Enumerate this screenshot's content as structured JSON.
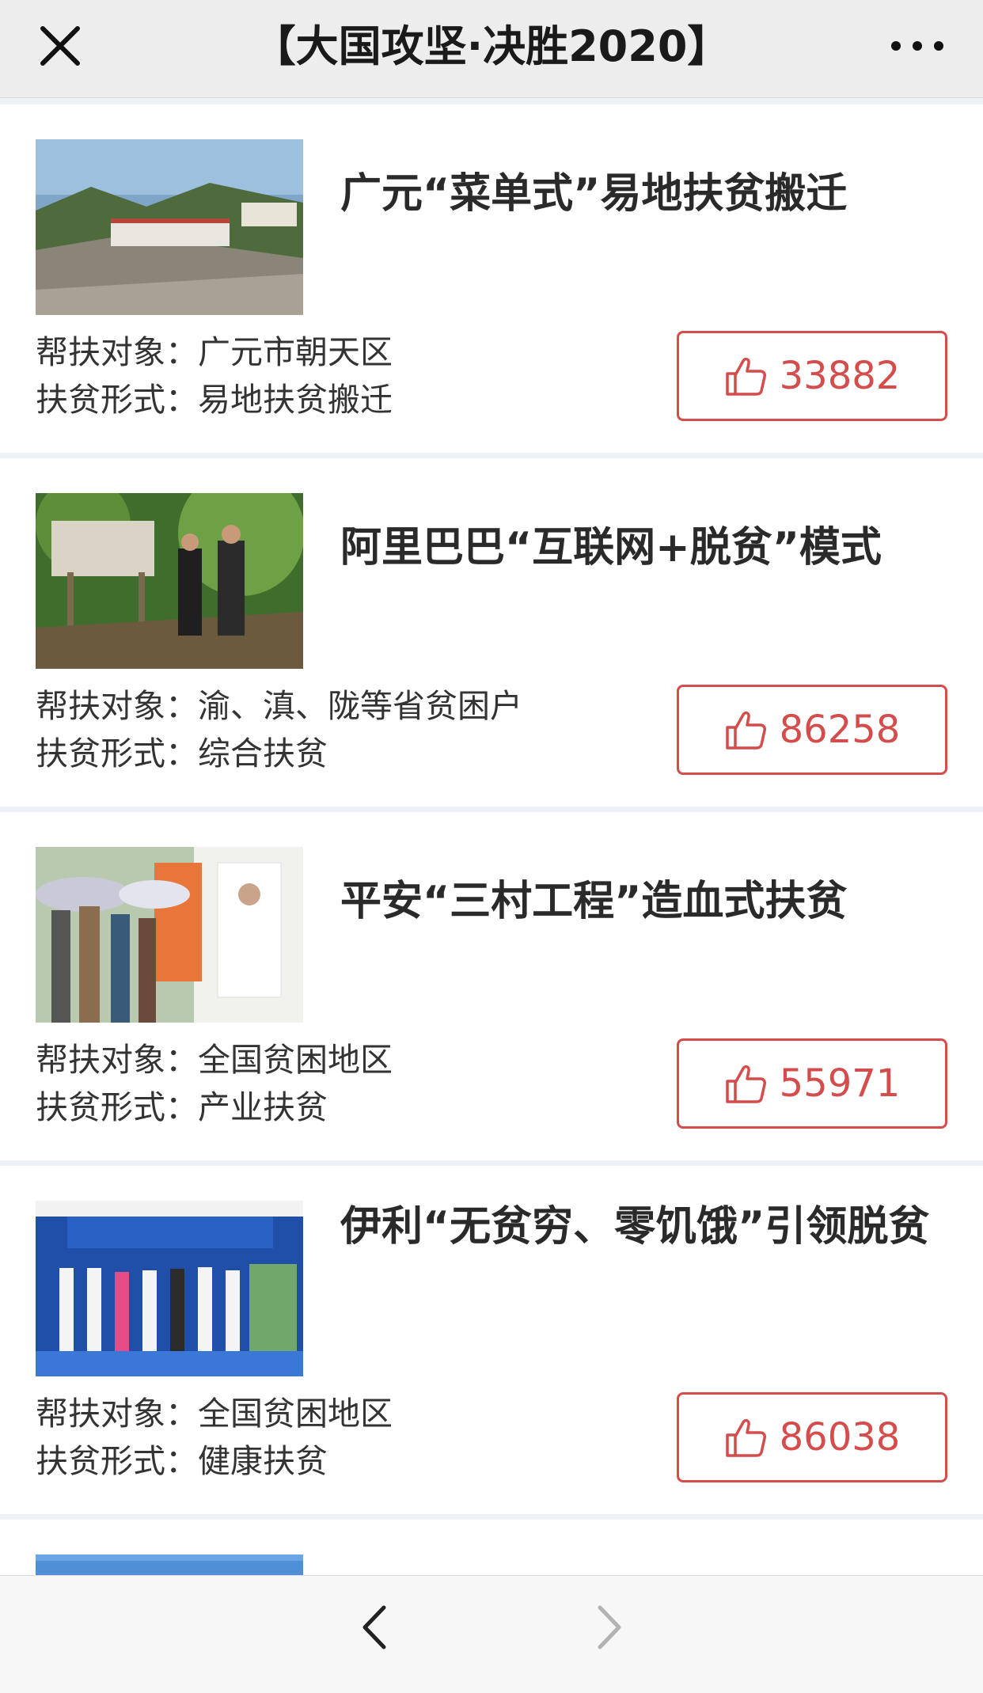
{
  "header": {
    "title": "【大国攻坚·决胜2020】",
    "close_icon": "close-icon",
    "more_icon": "more-icon"
  },
  "colors": {
    "accent": "#d44c4c",
    "background": "#eef2f6",
    "card": "#ffffff"
  },
  "cards": [
    {
      "title": "广元“菜单式”易地扶贫搬迁",
      "target_label": "帮扶对象：",
      "target_value": "广元市朝天区",
      "form_label": "扶贫形式：",
      "form_value": "易地扶贫搬迁",
      "likes": "33882",
      "like_icon": "thumbs-up-icon"
    },
    {
      "title": "阿里巴巴“互联网+脱贫”模式",
      "target_label": "帮扶对象：",
      "target_value": "渝、滇、陇等省贫困户",
      "form_label": "扶贫形式：",
      "form_value": "综合扶贫",
      "likes": "86258",
      "like_icon": "thumbs-up-icon"
    },
    {
      "title": "平安“三村工程”造血式扶贫",
      "target_label": "帮扶对象：",
      "target_value": "全国贫困地区",
      "form_label": "扶贫形式：",
      "form_value": "产业扶贫",
      "likes": "55971",
      "like_icon": "thumbs-up-icon"
    },
    {
      "title": "伊利“无贫穷、零饥饿”引领脱贫",
      "target_label": "帮扶对象：",
      "target_value": "全国贫困地区",
      "form_label": "扶贫形式：",
      "form_value": "健康扶贫",
      "likes": "86038",
      "like_icon": "thumbs-up-icon"
    }
  ],
  "bottom_nav": {
    "back_icon": "chevron-left-icon",
    "forward_icon": "chevron-right-icon"
  }
}
